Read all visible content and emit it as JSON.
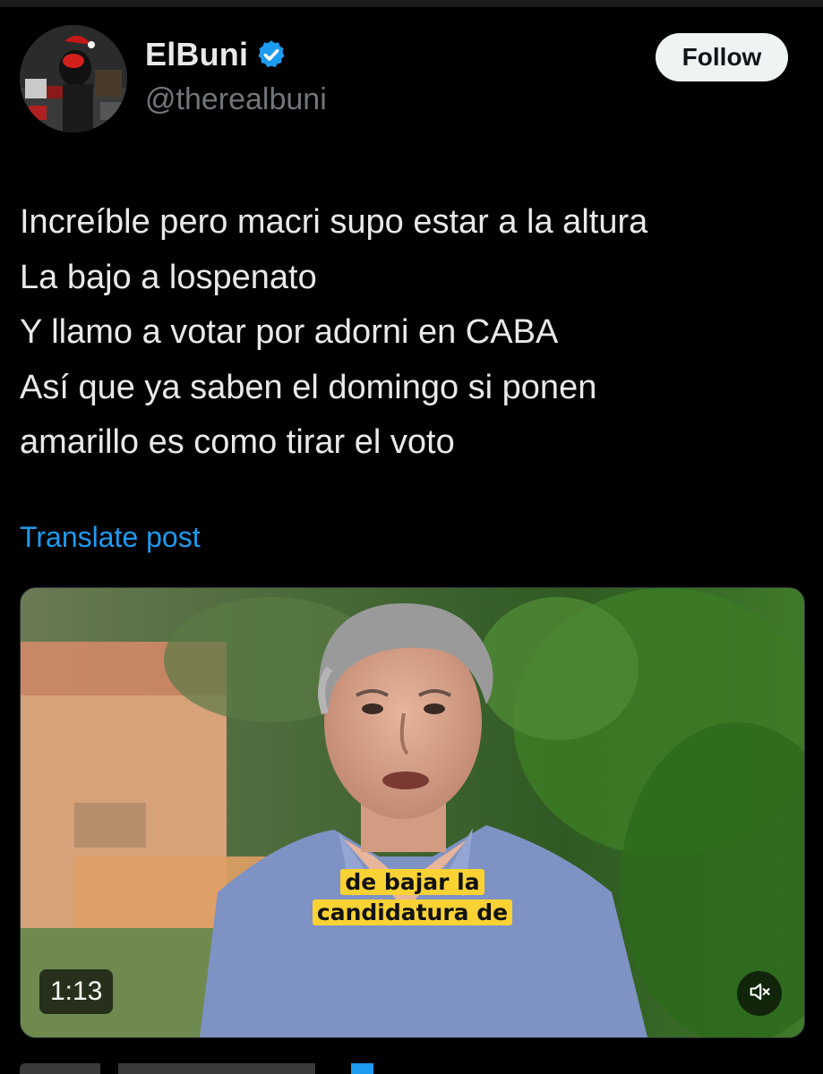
{
  "author": {
    "display_name": "ElBuni",
    "handle": "@therealbuni",
    "verified": true,
    "avatar_icon": "avatar-image"
  },
  "follow_label": "Follow",
  "post": {
    "lines": [
      "Increíble pero macri supo estar a la altura",
      "La bajo a lospenato",
      "Y llamo a votar por adorni en CABA",
      "Así que ya saben el domingo si ponen",
      "amarillo es como tirar el voto"
    ]
  },
  "translate_label": "Translate post",
  "video": {
    "caption_line1": "de bajar la",
    "caption_line2": "candidatura de",
    "duration": "1:13",
    "mute_icon": "muted-speaker-icon"
  },
  "colors": {
    "background": "#000000",
    "text_primary": "#e7e9ea",
    "text_secondary": "#71767b",
    "link_blue": "#1d9bf0",
    "verified_blue": "#1d9bf0",
    "caption_yellow": "#fbd234"
  }
}
